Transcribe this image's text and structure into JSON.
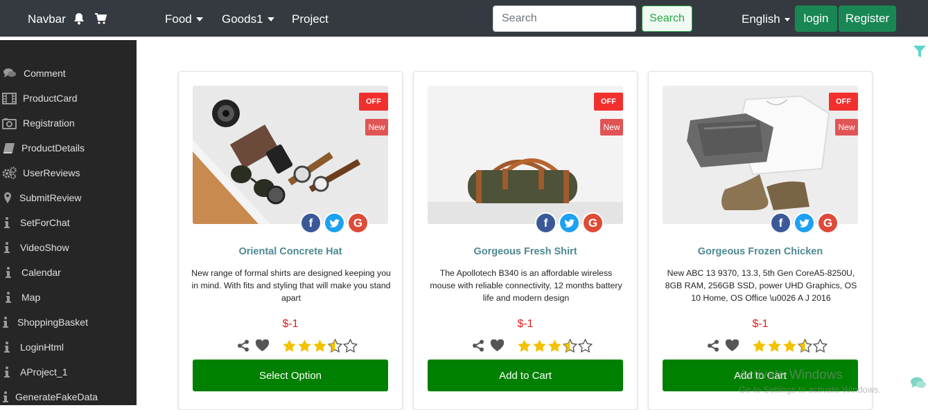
{
  "navbar": {
    "brand": "Navbar",
    "icons": [
      "bell-icon",
      "cart-icon"
    ],
    "menus": [
      {
        "label": "Food",
        "dropdown": true
      },
      {
        "label": "Goods1",
        "dropdown": true
      },
      {
        "label": "Project",
        "dropdown": false
      }
    ],
    "search_placeholder": "Search",
    "search_button": "Search",
    "language": "English",
    "login": "login",
    "register": "Register"
  },
  "sidebar": {
    "items": [
      {
        "label": "Comment",
        "icon": "comments-icon"
      },
      {
        "label": "ProductCard",
        "icon": "film-icon"
      },
      {
        "label": "Registration",
        "icon": "camera-icon"
      },
      {
        "label": "ProductDetails",
        "icon": "book-icon"
      },
      {
        "label": "UserReviews",
        "icon": "cogs-icon"
      },
      {
        "label": "SubmitReview",
        "icon": "map-marker-icon"
      },
      {
        "label": "SetForChat",
        "icon": "info-icon"
      },
      {
        "label": "VideoShow",
        "icon": "info-icon"
      },
      {
        "label": "Calendar",
        "icon": "info-icon"
      },
      {
        "label": "Map",
        "icon": "info-icon"
      },
      {
        "label": "ShoppingBasket",
        "icon": "info-icon"
      },
      {
        "label": "LoginHtml",
        "icon": "info-icon"
      },
      {
        "label": "AProject_1",
        "icon": "info-icon"
      },
      {
        "label": "GenerateFakeData",
        "icon": "info-icon"
      }
    ]
  },
  "products": [
    {
      "badge_off": "OFF",
      "badge_new": "New",
      "title": "Oriental Concrete Hat",
      "description": "New range of formal shirts are designed keeping you in mind. With fits and styling that will make you stand apart",
      "price": "$-1",
      "rating": 3.5,
      "button": "Select Option"
    },
    {
      "badge_off": "OFF",
      "badge_new": "New",
      "title": "Gorgeous Fresh Shirt",
      "description": "The Apollotech B340 is an affordable wireless mouse with reliable connectivity, 12 months battery life and modern design",
      "price": "$-1",
      "rating": 3.5,
      "button": "Add to Cart"
    },
    {
      "badge_off": "OFF",
      "badge_new": "New",
      "title": "Gorgeous Frozen Chicken",
      "description": "New ABC 13 9370, 13.3, 5th Gen CoreA5-8250U, 8GB RAM, 256GB SSD, power UHD Graphics, OS 10 Home, OS Office \\u0026 A J 2016",
      "price": "$-1",
      "rating": 3.5,
      "button": "Add to Cart"
    }
  ],
  "social": [
    "facebook-icon",
    "twitter-icon",
    "google-icon"
  ],
  "watermark": {
    "line1": "Activate Windows",
    "line2": "Go to Settings to activate Windows."
  },
  "colors": {
    "navbar_bg": "#343a40",
    "sidebar_bg": "#262626",
    "accent_green": "#198754",
    "cta_green": "#008000",
    "title_teal": "#4d8a91",
    "price_red": "#e31b1b",
    "star_gold": "#f2c200"
  }
}
